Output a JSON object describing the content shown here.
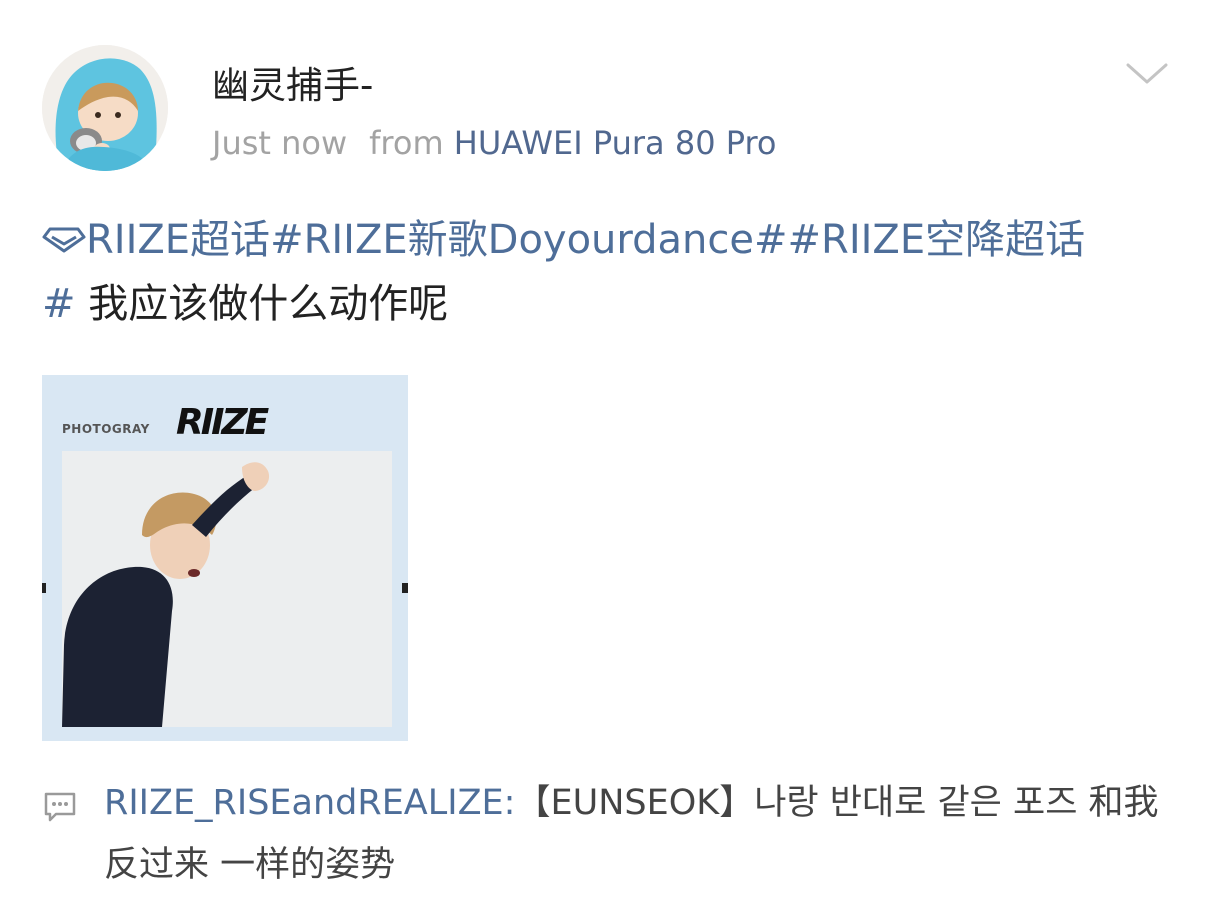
{
  "post": {
    "username": "幽灵捕手-",
    "timestamp": "Just now",
    "from_label": "from",
    "device": "HUAWEI Pura 80 Pro",
    "menu_icon": "chevron-down-icon"
  },
  "content": {
    "supertopic_icon": "diamond-icon",
    "tag1": "RIIZE超话",
    "tag2": "#RIIZE新歌Doyourdance#",
    "tag3": "#RIIZE空降超话",
    "tag3_end": "#",
    "text": " 我应该做什么动作呢"
  },
  "media": {
    "brand_small": "PHOTOGRAY",
    "brand_logo": "RIIZE"
  },
  "repost": {
    "icon": "comment-icon",
    "user": "RIIZE_RISEandREALIZE:",
    "text": "【EUNSEOK】나랑 반대로 같은 포즈 和我反过来 一样的姿势"
  },
  "colors": {
    "link": "#4e6e99",
    "meta_gray": "#a3a3a3",
    "text": "#222222"
  }
}
